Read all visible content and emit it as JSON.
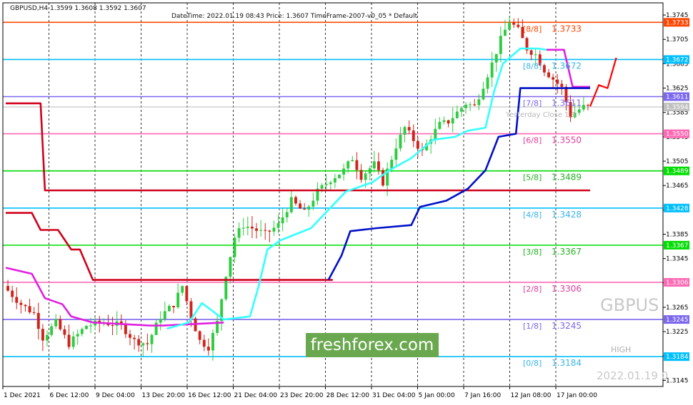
{
  "header": {
    "symbol_line": "GBPUSD,H4  1.3599 1.3608 1.3592 1.3607",
    "info_line": "DateTime: 2022.01.19 08:43    Price: 1.3607    TimeFrame-2007-v0_05    *  Default"
  },
  "watermark": {
    "brand": "freshforex.com",
    "symbol": "GBPUS",
    "high_label": "HIGH",
    "timestamp": "2022.01.19 0"
  },
  "colors": {
    "axis": "#000000",
    "grid": "#000000",
    "bull": "#2ecc40",
    "bear": "#d0231b",
    "trail_red": "#d0021b",
    "trail_magenta": "#e020e0",
    "trail_cyan": "#33ffff",
    "trail_blue": "#0010c8",
    "forecast": "#ff0000"
  },
  "chart_data": {
    "type": "candlestick",
    "symbol": "GBPUSD",
    "timeframe": "H4",
    "y_range": [
      1.3135,
      1.3765
    ],
    "x_ticks": [
      "1 Dec 2021",
      "6 Dec 12:00",
      "9 Dec 04:00",
      "13 Dec 20:00",
      "16 Dec 12:00",
      "21 Dec 04:00",
      "23 Dec 20:00",
      "28 Dec 12:00",
      "31 Dec 04:00",
      "5 Jan 00:00",
      "7 Jan 16:00",
      "12 Jan 08:00",
      "17 Jan 00:00"
    ],
    "y_ticks": [
      "1.3745",
      "1.3705",
      "1.3665",
      "1.3625",
      "1.3585",
      "1.3545",
      "1.3505",
      "1.3465",
      "1.3425",
      "1.3385",
      "1.3345",
      "1.3305",
      "1.3265",
      "1.3225",
      "1.3185",
      "1.3145"
    ],
    "murrey_levels": [
      {
        "label": "[8/8]",
        "value": 1.3733,
        "text": "1.3733",
        "color": "#ff4500",
        "label_color": "#ff4500"
      },
      {
        "label": "[8/8]",
        "value": 1.3672,
        "text": "1.3672",
        "color": "#00bfff",
        "label_color": "#3ab4e8"
      },
      {
        "label": "[7/8]",
        "value": 1.3611,
        "text": "1.3611",
        "color": "#7b68ee",
        "label_color": "#7b68ee"
      },
      {
        "label": "[6/8]",
        "value": 1.355,
        "text": "1.3550",
        "color": "#ff69b4",
        "label_color": "#e0409a"
      },
      {
        "label": "[5/8]",
        "value": 1.3489,
        "text": "1.3489",
        "color": "#00dd00",
        "label_color": "#22b222"
      },
      {
        "label": "[4/8]",
        "value": 1.3428,
        "text": "1.3428",
        "color": "#00bfff",
        "label_color": "#3ab4e8"
      },
      {
        "label": "[3/8]",
        "value": 1.3367,
        "text": "1.3367",
        "color": "#00dd00",
        "label_color": "#22b222"
      },
      {
        "label": "[2/8]",
        "value": 1.3306,
        "text": "1.3306",
        "color": "#ff69b4",
        "label_color": "#e0409a"
      },
      {
        "label": "[1/8]",
        "value": 1.3245,
        "text": "1.3245",
        "color": "#7b68ee",
        "label_color": "#7b68ee"
      },
      {
        "label": "[0/8]",
        "value": 1.3184,
        "text": "1.3184",
        "color": "#00bfff",
        "label_color": "#3ab4e8"
      }
    ],
    "current_price": 1.3594,
    "current_price_text": "1.3594",
    "yesterday_close_label": "Yesterday Close 1.3",
    "red_line_level": 1.3457,
    "price_path": [
      [
        0,
        1.33
      ],
      [
        4,
        1.327
      ],
      [
        7,
        1.3255
      ],
      [
        9,
        1.3215
      ],
      [
        12,
        1.324
      ],
      [
        15,
        1.3205
      ],
      [
        19,
        1.3235
      ],
      [
        23,
        1.324
      ],
      [
        27,
        1.3235
      ],
      [
        30,
        1.321
      ],
      [
        33,
        1.3205
      ],
      [
        36,
        1.325
      ],
      [
        39,
        1.327
      ],
      [
        41,
        1.33
      ],
      [
        43,
        1.325
      ],
      [
        45,
        1.321
      ],
      [
        47,
        1.32
      ],
      [
        49,
        1.324
      ],
      [
        51,
        1.332
      ],
      [
        53,
        1.338
      ],
      [
        55,
        1.34
      ],
      [
        57,
        1.3395
      ],
      [
        60,
        1.3385
      ],
      [
        63,
        1.34
      ],
      [
        66,
        1.344
      ],
      [
        69,
        1.342
      ],
      [
        72,
        1.3455
      ],
      [
        75,
        1.3475
      ],
      [
        78,
        1.349
      ],
      [
        80,
        1.351
      ],
      [
        82,
        1.348
      ],
      [
        85,
        1.35
      ],
      [
        87,
        1.347
      ],
      [
        90,
        1.353
      ],
      [
        92,
        1.356
      ],
      [
        94,
        1.354
      ],
      [
        96,
        1.352
      ],
      [
        98,
        1.3545
      ],
      [
        100,
        1.3565
      ],
      [
        102,
        1.357
      ],
      [
        104,
        1.3585
      ],
      [
        106,
        1.36
      ],
      [
        108,
        1.3595
      ],
      [
        110,
        1.363
      ],
      [
        112,
        1.3665
      ],
      [
        114,
        1.3705
      ],
      [
        116,
        1.3735
      ],
      [
        118,
        1.372
      ],
      [
        120,
        1.369
      ],
      [
        122,
        1.368
      ],
      [
        124,
        1.3655
      ],
      [
        126,
        1.364
      ],
      [
        128,
        1.3625
      ],
      [
        130,
        1.358
      ],
      [
        132,
        1.359
      ],
      [
        133,
        1.3594
      ]
    ],
    "n_bars": 134,
    "trail_red": [
      [
        0,
        1.36
      ],
      [
        8,
        1.36
      ],
      [
        9,
        1.3457
      ],
      [
        134,
        1.3457
      ]
    ],
    "trail_red_lower": [
      [
        0,
        1.342
      ],
      [
        6,
        1.342
      ],
      [
        8,
        1.3392
      ],
      [
        12,
        1.3392
      ],
      [
        15,
        1.336
      ],
      [
        17,
        1.336
      ],
      [
        20,
        1.331
      ],
      [
        75,
        1.331
      ]
    ],
    "trail_magenta": [
      [
        0,
        1.333
      ],
      [
        6,
        1.332
      ],
      [
        9,
        1.328
      ],
      [
        13,
        1.327
      ],
      [
        15,
        1.325
      ],
      [
        20,
        1.324
      ],
      [
        33,
        1.3235
      ],
      [
        36,
        1.3235
      ],
      [
        50,
        1.324
      ]
    ],
    "trail_magenta_top": [
      [
        124,
        1.3688
      ],
      [
        128,
        1.3688
      ],
      [
        130,
        1.3627
      ],
      [
        134,
        1.3627
      ]
    ],
    "trail_cyan": [
      [
        37,
        1.323
      ],
      [
        42,
        1.324
      ],
      [
        45,
        1.3272
      ],
      [
        50,
        1.3245
      ],
      [
        56,
        1.325
      ],
      [
        58,
        1.33
      ],
      [
        60,
        1.336
      ],
      [
        63,
        1.3375
      ],
      [
        70,
        1.3395
      ],
      [
        78,
        1.3455
      ],
      [
        84,
        1.347
      ],
      [
        88,
        1.349
      ],
      [
        93,
        1.351
      ],
      [
        98,
        1.354
      ],
      [
        103,
        1.3545
      ],
      [
        106,
        1.3555
      ],
      [
        110,
        1.356
      ],
      [
        112,
        1.362
      ],
      [
        114,
        1.3665
      ],
      [
        118,
        1.369
      ],
      [
        122,
        1.369
      ],
      [
        124,
        1.3688
      ]
    ],
    "trail_blue": [
      [
        74,
        1.331
      ],
      [
        77,
        1.335
      ],
      [
        79,
        1.339
      ],
      [
        85,
        1.3395
      ],
      [
        93,
        1.34
      ],
      [
        95,
        1.343
      ],
      [
        101,
        1.344
      ],
      [
        106,
        1.346
      ],
      [
        110,
        1.349
      ],
      [
        113,
        1.3545
      ],
      [
        117,
        1.355
      ],
      [
        118,
        1.3625
      ],
      [
        134,
        1.3625
      ]
    ],
    "forecast": [
      [
        134,
        1.3595
      ],
      [
        136,
        1.363
      ],
      [
        138,
        1.3625
      ],
      [
        140,
        1.3675
      ]
    ]
  }
}
